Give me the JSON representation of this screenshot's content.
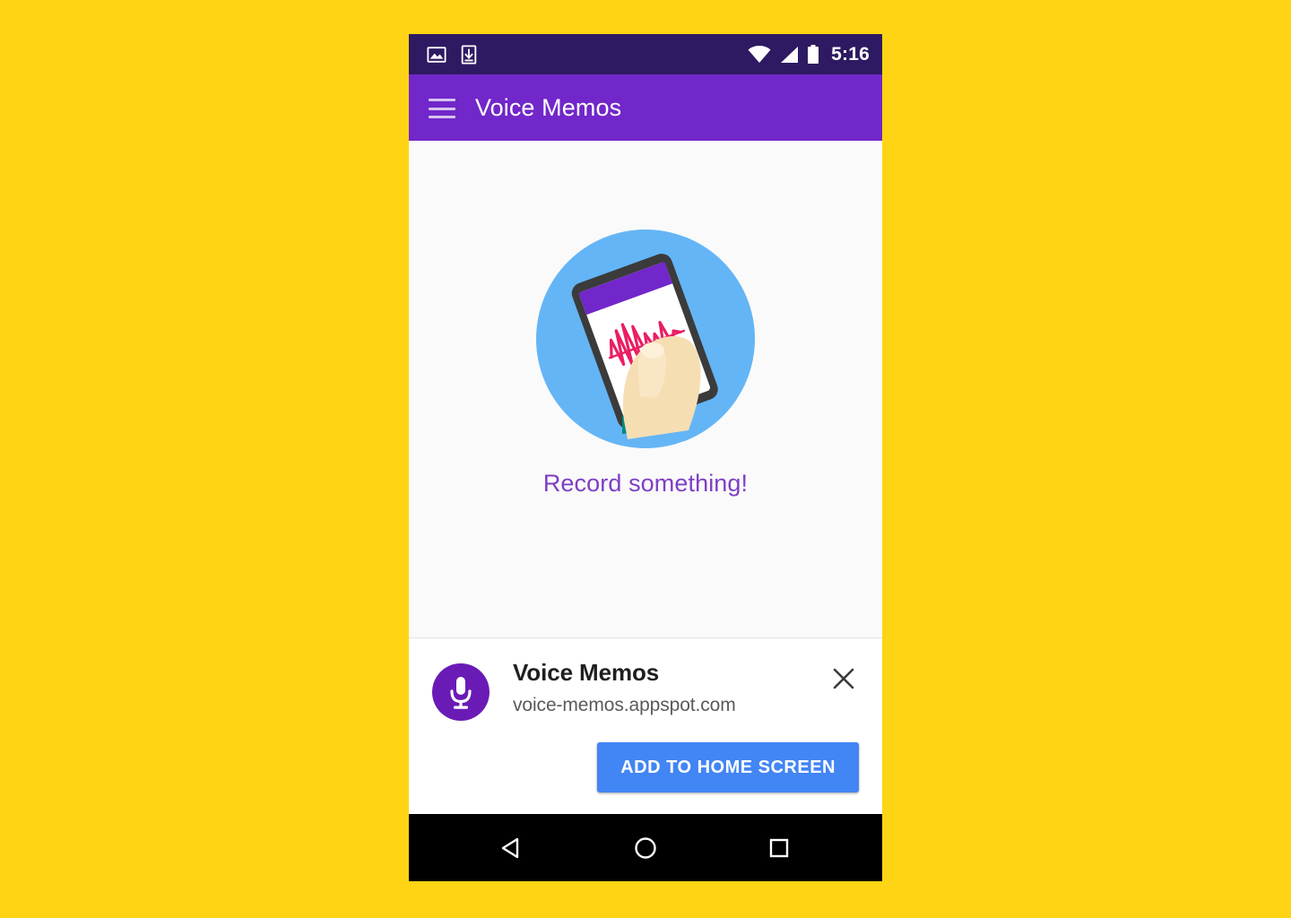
{
  "background_color": "#FFD414",
  "status_bar": {
    "background": "#2e1a62",
    "time": "5:16",
    "left_icons": [
      "image-icon",
      "download-icon"
    ],
    "right_icons": [
      "wifi-icon",
      "cellular-signal-icon",
      "battery-icon"
    ]
  },
  "app_bar": {
    "background": "#7127c9",
    "menu_icon": "hamburger-menu-icon",
    "title": "Voice Memos"
  },
  "content": {
    "background": "#fafafa",
    "illustration": {
      "name": "hand-holding-phone-illustration",
      "circle_color": "#64b5f6",
      "phone_body_color": "#3b3b3b",
      "phone_screen_color": "#ffffff",
      "phone_header_color": "#7127c9",
      "waveform_color": "#e91e63",
      "skin_color": "#f6deb3",
      "sleeve_color": "#00897b"
    },
    "empty_state_text": "Record something!",
    "empty_state_color": "#7e3fc4"
  },
  "install_banner": {
    "background": "#ffffff",
    "app_icon": "microphone-icon",
    "app_icon_background": "#6a1bb5",
    "title": "Voice Memos",
    "url": "voice-memos.appspot.com",
    "close_icon": "close-icon",
    "add_button_label": "ADD TO HOME SCREEN",
    "add_button_color": "#4285f4"
  },
  "nav_bar": {
    "background": "#000000",
    "buttons": [
      {
        "name": "back-button",
        "icon": "back-triangle-icon"
      },
      {
        "name": "home-button",
        "icon": "home-circle-icon"
      },
      {
        "name": "recents-button",
        "icon": "recents-square-icon"
      }
    ]
  }
}
